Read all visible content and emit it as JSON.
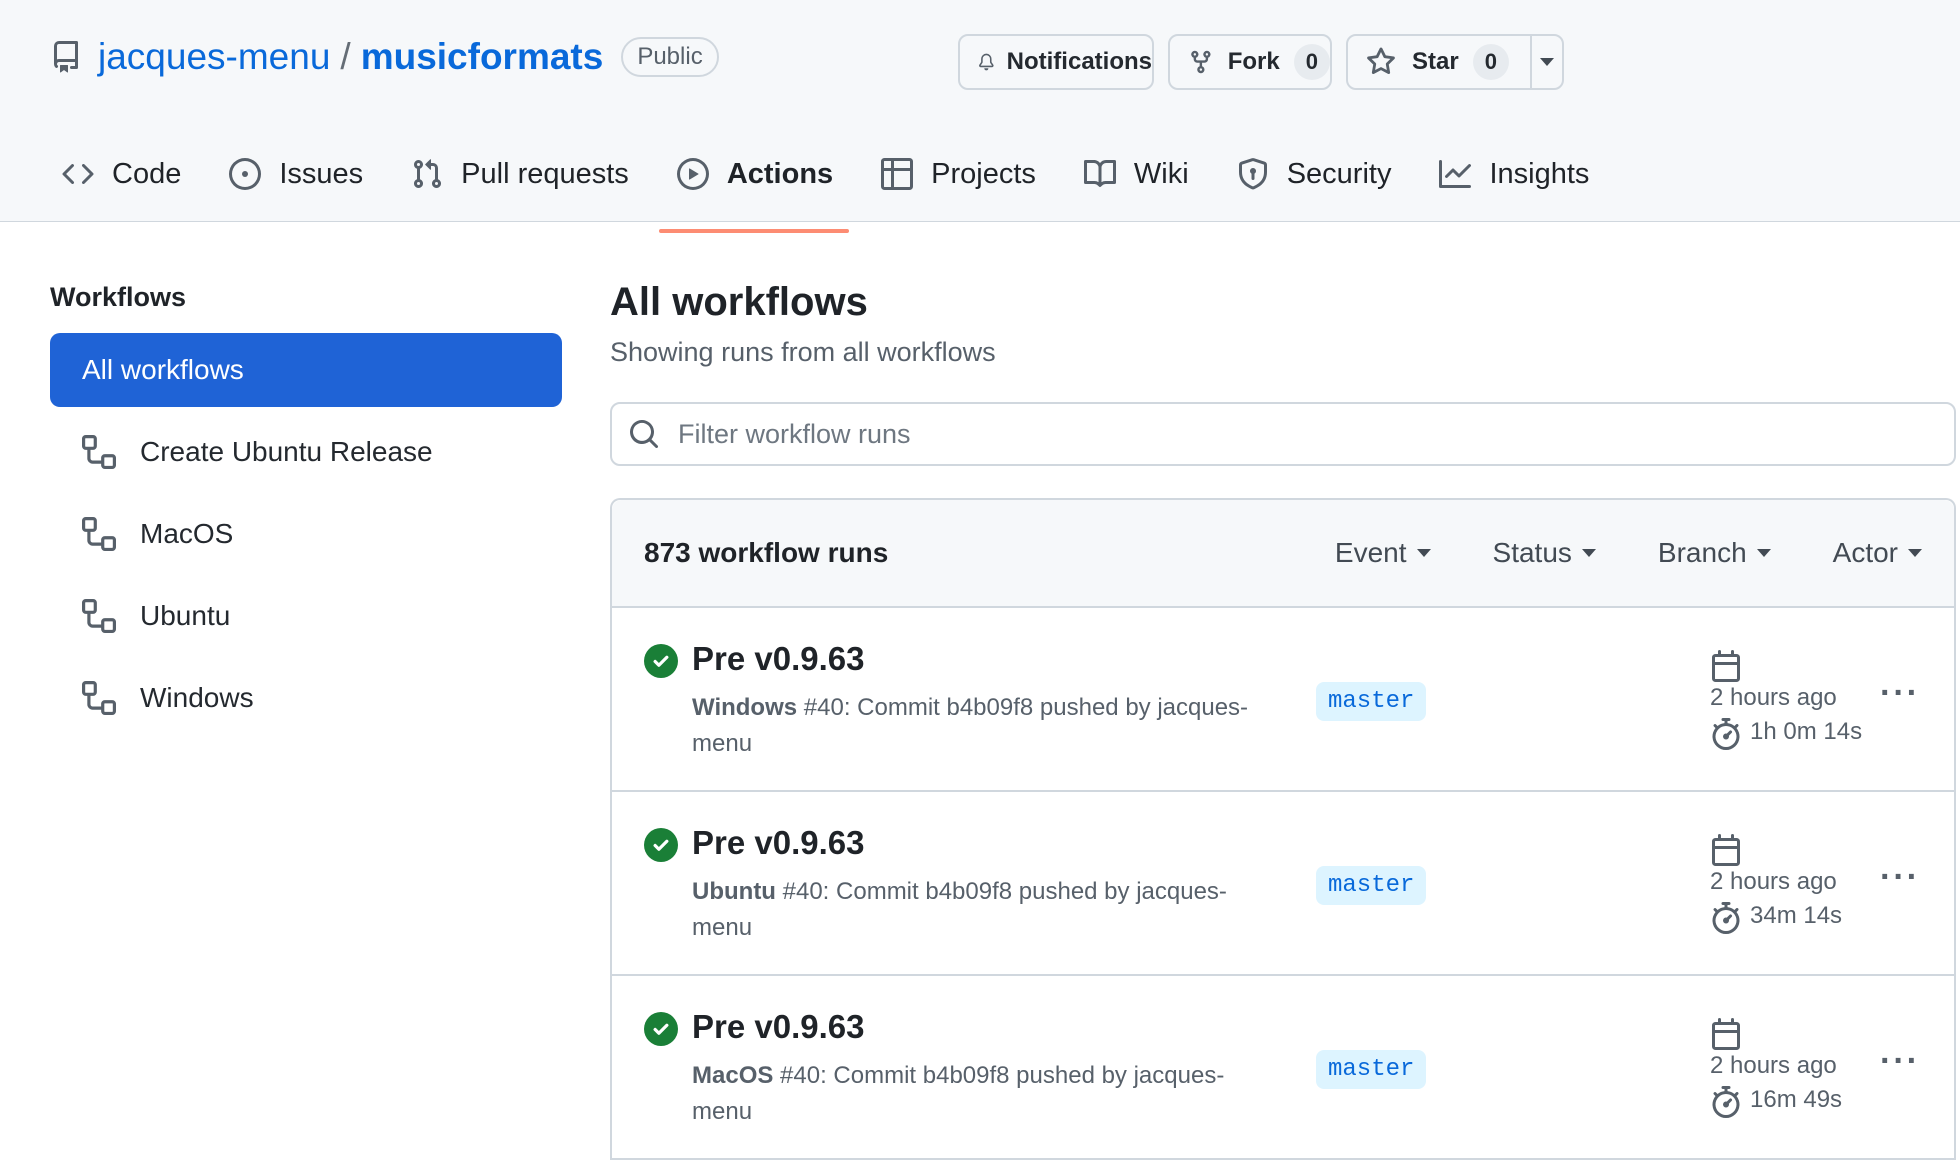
{
  "repo": {
    "owner": "jacques-menu",
    "separator": "/",
    "name": "musicformats",
    "visibility": "Public"
  },
  "header_buttons": {
    "notifications": "Notifications",
    "fork": {
      "label": "Fork",
      "count": "0"
    },
    "star": {
      "label": "Star",
      "count": "0"
    }
  },
  "tabs": [
    {
      "label": "Code",
      "icon": "code-icon"
    },
    {
      "label": "Issues",
      "icon": "issue-icon"
    },
    {
      "label": "Pull requests",
      "icon": "pull-request-icon"
    },
    {
      "label": "Actions",
      "icon": "play-icon",
      "active": true
    },
    {
      "label": "Projects",
      "icon": "table-icon"
    },
    {
      "label": "Wiki",
      "icon": "book-icon"
    },
    {
      "label": "Security",
      "icon": "shield-icon"
    },
    {
      "label": "Insights",
      "icon": "graph-icon"
    }
  ],
  "sidebar": {
    "heading": "Workflows",
    "items": [
      {
        "label": "All workflows",
        "active": true
      },
      {
        "label": "Create Ubuntu Release",
        "icon": "workflow-icon"
      },
      {
        "label": "MacOS",
        "icon": "workflow-icon"
      },
      {
        "label": "Ubuntu",
        "icon": "workflow-icon"
      },
      {
        "label": "Windows",
        "icon": "workflow-icon"
      }
    ]
  },
  "main": {
    "title": "All workflows",
    "subtitle": "Showing runs from all workflows",
    "filter_placeholder": "Filter workflow runs",
    "runs_count": "873 workflow runs",
    "filters": [
      "Event",
      "Status",
      "Branch",
      "Actor"
    ]
  },
  "runs": [
    {
      "title": "Pre v0.9.63",
      "workflow": "Windows",
      "detail": " #40: Commit b4b09f8 pushed by jacques-menu",
      "branch": "master",
      "ago": "2 hours ago",
      "duration": "1h 0m 14s",
      "status": "success"
    },
    {
      "title": "Pre v0.9.63",
      "workflow": "Ubuntu",
      "detail": " #40: Commit b4b09f8 pushed by jacques-menu",
      "branch": "master",
      "ago": "2 hours ago",
      "duration": "34m 14s",
      "status": "success"
    },
    {
      "title": "Pre v0.9.63",
      "workflow": "MacOS",
      "detail": " #40: Commit b4b09f8 pushed by jacques-menu",
      "branch": "master",
      "ago": "2 hours ago",
      "duration": "16m 49s",
      "status": "success"
    }
  ],
  "colors": {
    "accent": "#0969da",
    "active_nav": "#1f63d6",
    "tab_underline": "#fd8c73",
    "success": "#1a7f37"
  }
}
